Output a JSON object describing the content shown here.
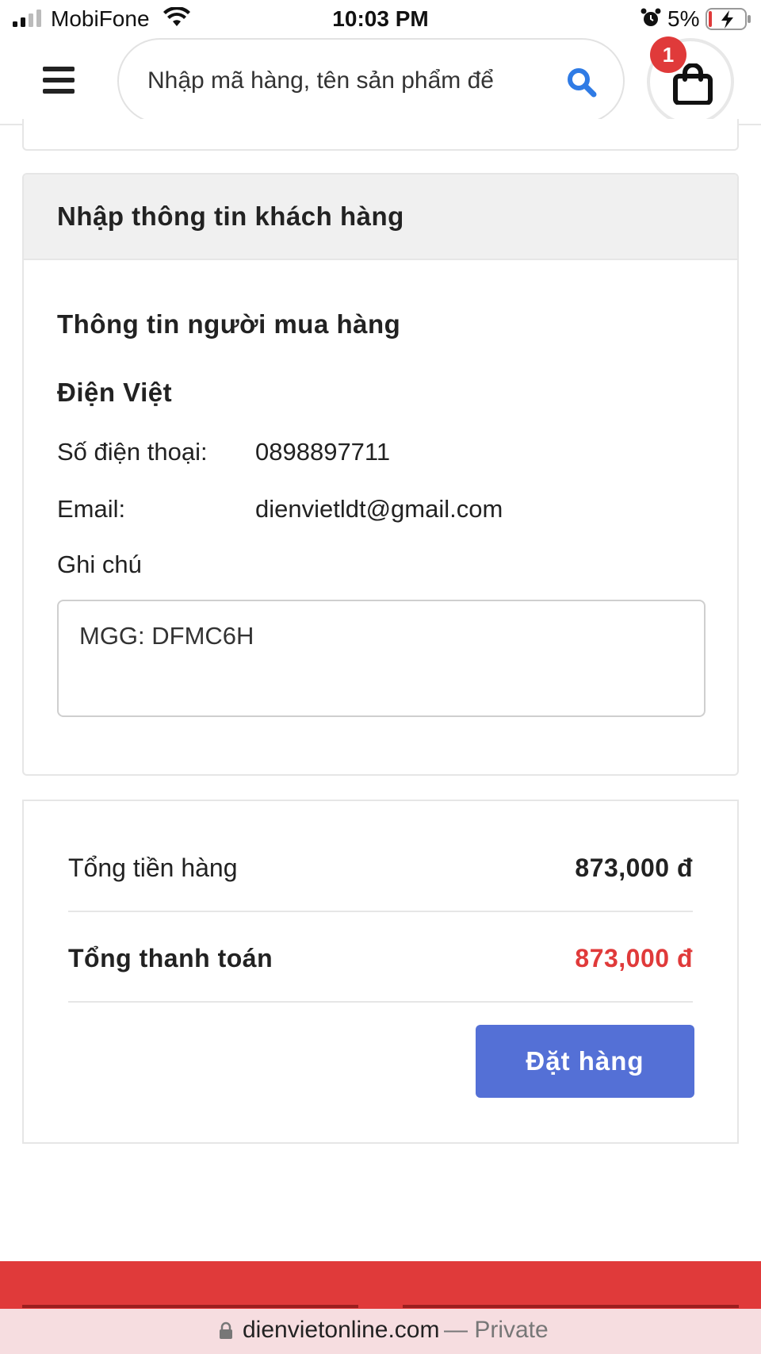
{
  "status_bar": {
    "carrier": "MobiFone",
    "time": "10:03 PM",
    "battery": "5%"
  },
  "header": {
    "search_placeholder": "Nhập mã hàng, tên sản phẩm để",
    "cart_count": "1"
  },
  "customer_form": {
    "title": "Nhập thông tin khách hàng",
    "buyer_heading": "Thông tin người mua hàng",
    "buyer_name": "Điện Việt",
    "phone_label": "Số điện thoại:",
    "phone_value": "0898897711",
    "email_label": "Email:",
    "email_value": "dienvietldt@gmail.com",
    "note_label": "Ghi chú",
    "note_value": "MGG: DFMC6H"
  },
  "totals": {
    "subtotal_label": "Tổng tiền hàng",
    "subtotal_value": "873,000 đ",
    "grand_total_label": "Tổng thanh toán",
    "grand_total_value": "873,000 đ",
    "order_button": "Đặt hàng"
  },
  "browser": {
    "domain": "dienvietonline.com",
    "mode": "— Private"
  },
  "colors": {
    "accent_red": "#e03a3a",
    "button_blue": "#5470d6",
    "search_icon_blue": "#2f7be5"
  }
}
